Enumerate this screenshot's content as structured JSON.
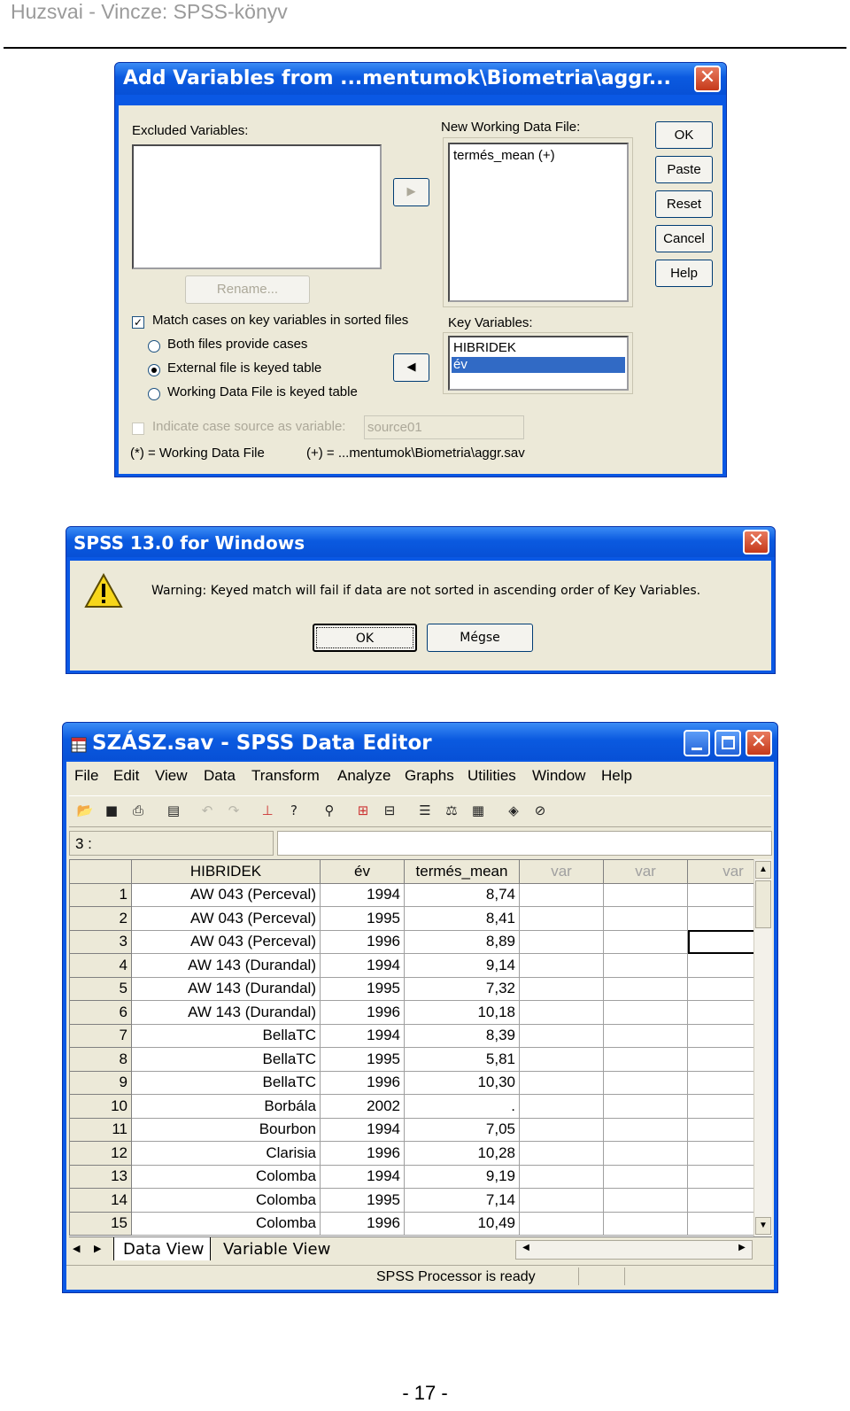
{
  "page_header": {
    "title": "Huzsvai - Vincze: SPSS-könyv"
  },
  "page_footer": {
    "page_number": "- 17 -"
  },
  "add_variables_dialog": {
    "title": "Add Variables from ...mentumok\\Biometria\\aggr...",
    "excluded_label": "Excluded Variables:",
    "new_working_label": "New Working Data File:",
    "new_working_items": [
      "termés_mean (+)"
    ],
    "buttons": {
      "ok": "OK",
      "paste": "Paste",
      "reset": "Reset",
      "cancel": "Cancel",
      "help": "Help",
      "rename": "Rename..."
    },
    "match_cases_label": "Match cases on key variables in sorted files",
    "match_cases_checked": true,
    "radio_both": "Both files provide cases",
    "radio_external": "External file is keyed table",
    "radio_working": "Working Data File is keyed table",
    "radio_selected": "External file is keyed table",
    "key_variables_label": "Key Variables:",
    "key_variables": [
      "HIBRIDEK",
      "év"
    ],
    "key_selected": "év",
    "indicate_label": "Indicate case source as variable:",
    "indicate_value": "source01",
    "legend_star": "(*) = Working Data File",
    "legend_plus": "(+) = ...mentumok\\Biometria\\aggr.sav"
  },
  "warning_dialog": {
    "title": "SPSS 13.0 for Windows",
    "message": "Warning: Keyed match will fail if data are not sorted in ascending order of Key Variables.",
    "ok": "OK",
    "cancel": "Mégse"
  },
  "data_editor": {
    "title": "SZÁSZ.sav - SPSS Data Editor",
    "menu": [
      "File",
      "Edit",
      "View",
      "Data",
      "Transform",
      "Analyze",
      "Graphs",
      "Utilities",
      "Window",
      "Help"
    ],
    "toolbar_icons": [
      "open-icon",
      "save-icon",
      "print-icon",
      "dialog-recall-icon",
      "undo-icon",
      "redo-icon",
      "goto-chart-icon",
      "goto-case-icon",
      "variables-icon",
      "find-icon",
      "insert-case-icon",
      "insert-variable-icon",
      "split-file-icon",
      "weight-cases-icon",
      "select-cases-icon",
      "value-labels-icon",
      "use-sets-icon"
    ],
    "cell_ref": "3 :",
    "columns": [
      "HIBRIDEK",
      "év",
      "termés_mean",
      "var",
      "var",
      "var"
    ],
    "rows": [
      [
        "1",
        "AW 043 (Perceval)",
        "1994",
        "8,74"
      ],
      [
        "2",
        "AW 043 (Perceval)",
        "1995",
        "8,41"
      ],
      [
        "3",
        "AW 043 (Perceval)",
        "1996",
        "8,89"
      ],
      [
        "4",
        "AW 143 (Durandal)",
        "1994",
        "9,14"
      ],
      [
        "5",
        "AW 143 (Durandal)",
        "1995",
        "7,32"
      ],
      [
        "6",
        "AW 143 (Durandal)",
        "1996",
        "10,18"
      ],
      [
        "7",
        "BellaTC",
        "1994",
        "8,39"
      ],
      [
        "8",
        "BellaTC",
        "1995",
        "5,81"
      ],
      [
        "9",
        "BellaTC",
        "1996",
        "10,30"
      ],
      [
        "10",
        "Borbála",
        "2002",
        "."
      ],
      [
        "11",
        "Bourbon",
        "1994",
        "7,05"
      ],
      [
        "12",
        "Clarisia",
        "1996",
        "10,28"
      ],
      [
        "13",
        "Colomba",
        "1994",
        "9,19"
      ],
      [
        "14",
        "Colomba",
        "1995",
        "7,14"
      ],
      [
        "15",
        "Colomba",
        "1996",
        "10,49"
      ]
    ],
    "tabs": {
      "data_view": "Data View",
      "variable_view": "Variable View"
    },
    "status": "SPSS Processor  is ready"
  }
}
